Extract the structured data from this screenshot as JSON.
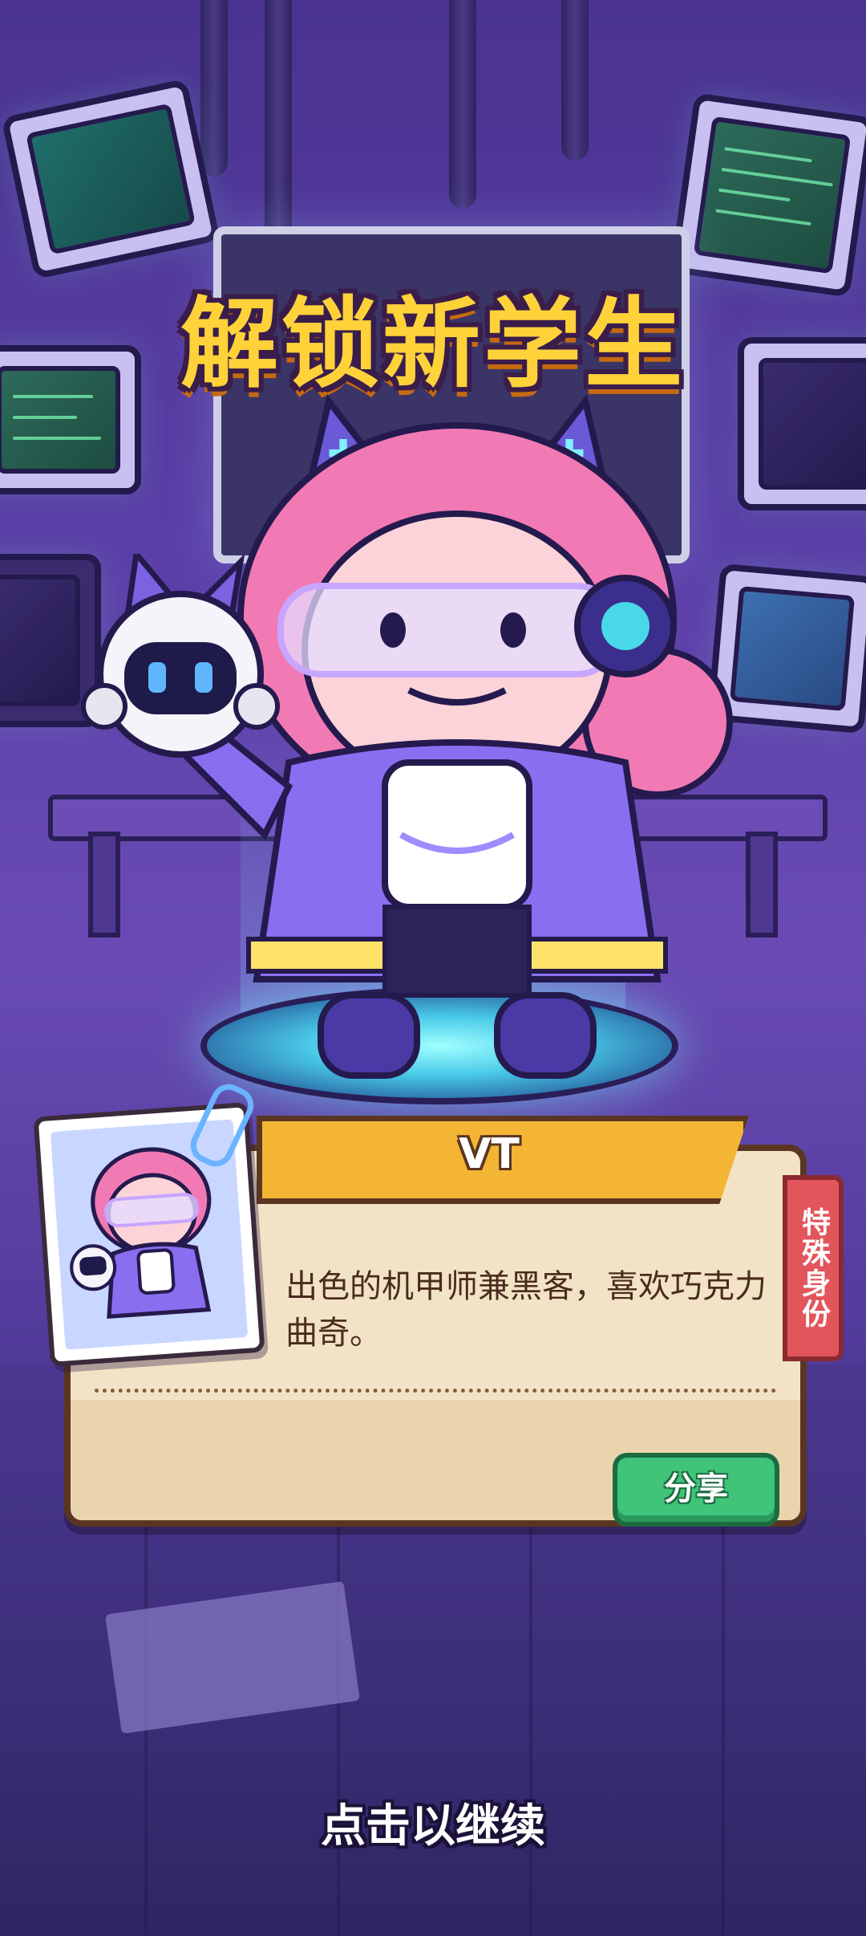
{
  "screen": {
    "title": "解锁新学生",
    "continue_hint": "点击以继续"
  },
  "student_card": {
    "name": "VT",
    "description": "出色的机甲师兼黑客，喜欢巧克力曲奇。",
    "tag": "特殊身份",
    "share_label": "分享"
  },
  "colors": {
    "title": "#ffd23a",
    "ribbon": "#f5b534",
    "share": "#3fc47a",
    "tag": "#e2555b",
    "card": "#f3e3c6"
  },
  "icons": [
    "robot-companion-icon",
    "paperclip-icon"
  ]
}
